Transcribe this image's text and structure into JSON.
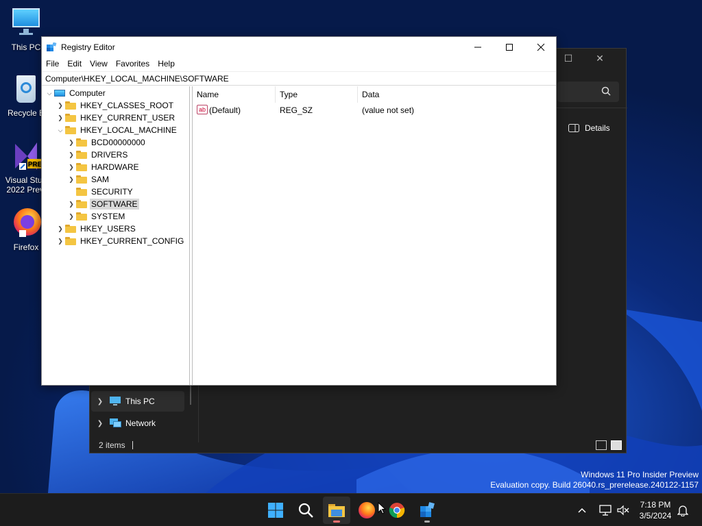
{
  "desktop": {
    "icons": [
      {
        "label": "This PC"
      },
      {
        "label": "Recycle B"
      },
      {
        "label": "Visual Stud\n2022 Previ",
        "badge": "PRE"
      },
      {
        "label": "Firefox"
      }
    ]
  },
  "explorer": {
    "details_label": "Details",
    "nav": [
      {
        "label": "This PC"
      },
      {
        "label": "Network"
      }
    ],
    "status": "2 items"
  },
  "regedit": {
    "title": "Registry Editor",
    "menu": [
      "File",
      "Edit",
      "View",
      "Favorites",
      "Help"
    ],
    "address": "Computer\\HKEY_LOCAL_MACHINE\\SOFTWARE",
    "tree": {
      "root": "Computer",
      "hives": [
        "HKEY_CLASSES_ROOT",
        "HKEY_CURRENT_USER",
        "HKEY_LOCAL_MACHINE",
        "HKEY_USERS",
        "HKEY_CURRENT_CONFIG"
      ],
      "hklm_children": [
        "BCD00000000",
        "DRIVERS",
        "HARDWARE",
        "SAM",
        "SECURITY",
        "SOFTWARE",
        "SYSTEM"
      ],
      "selected": "SOFTWARE"
    },
    "columns": [
      "Name",
      "Type",
      "Data"
    ],
    "values": [
      {
        "name": "(Default)",
        "type": "REG_SZ",
        "data": "(value not set)",
        "icon": "ab"
      }
    ]
  },
  "watermark": {
    "line1": "Windows 11 Pro Insider Preview",
    "line2": "Evaluation copy. Build 26040.rs_prerelease.240122-1157"
  },
  "clock": {
    "time": "7:18 PM",
    "date": "3/5/2024"
  },
  "colors": {
    "taskbar": "#1c1c1c",
    "explorer_bg": "#202020",
    "folder": "#f4c542",
    "selection": "#d9d9d9"
  }
}
